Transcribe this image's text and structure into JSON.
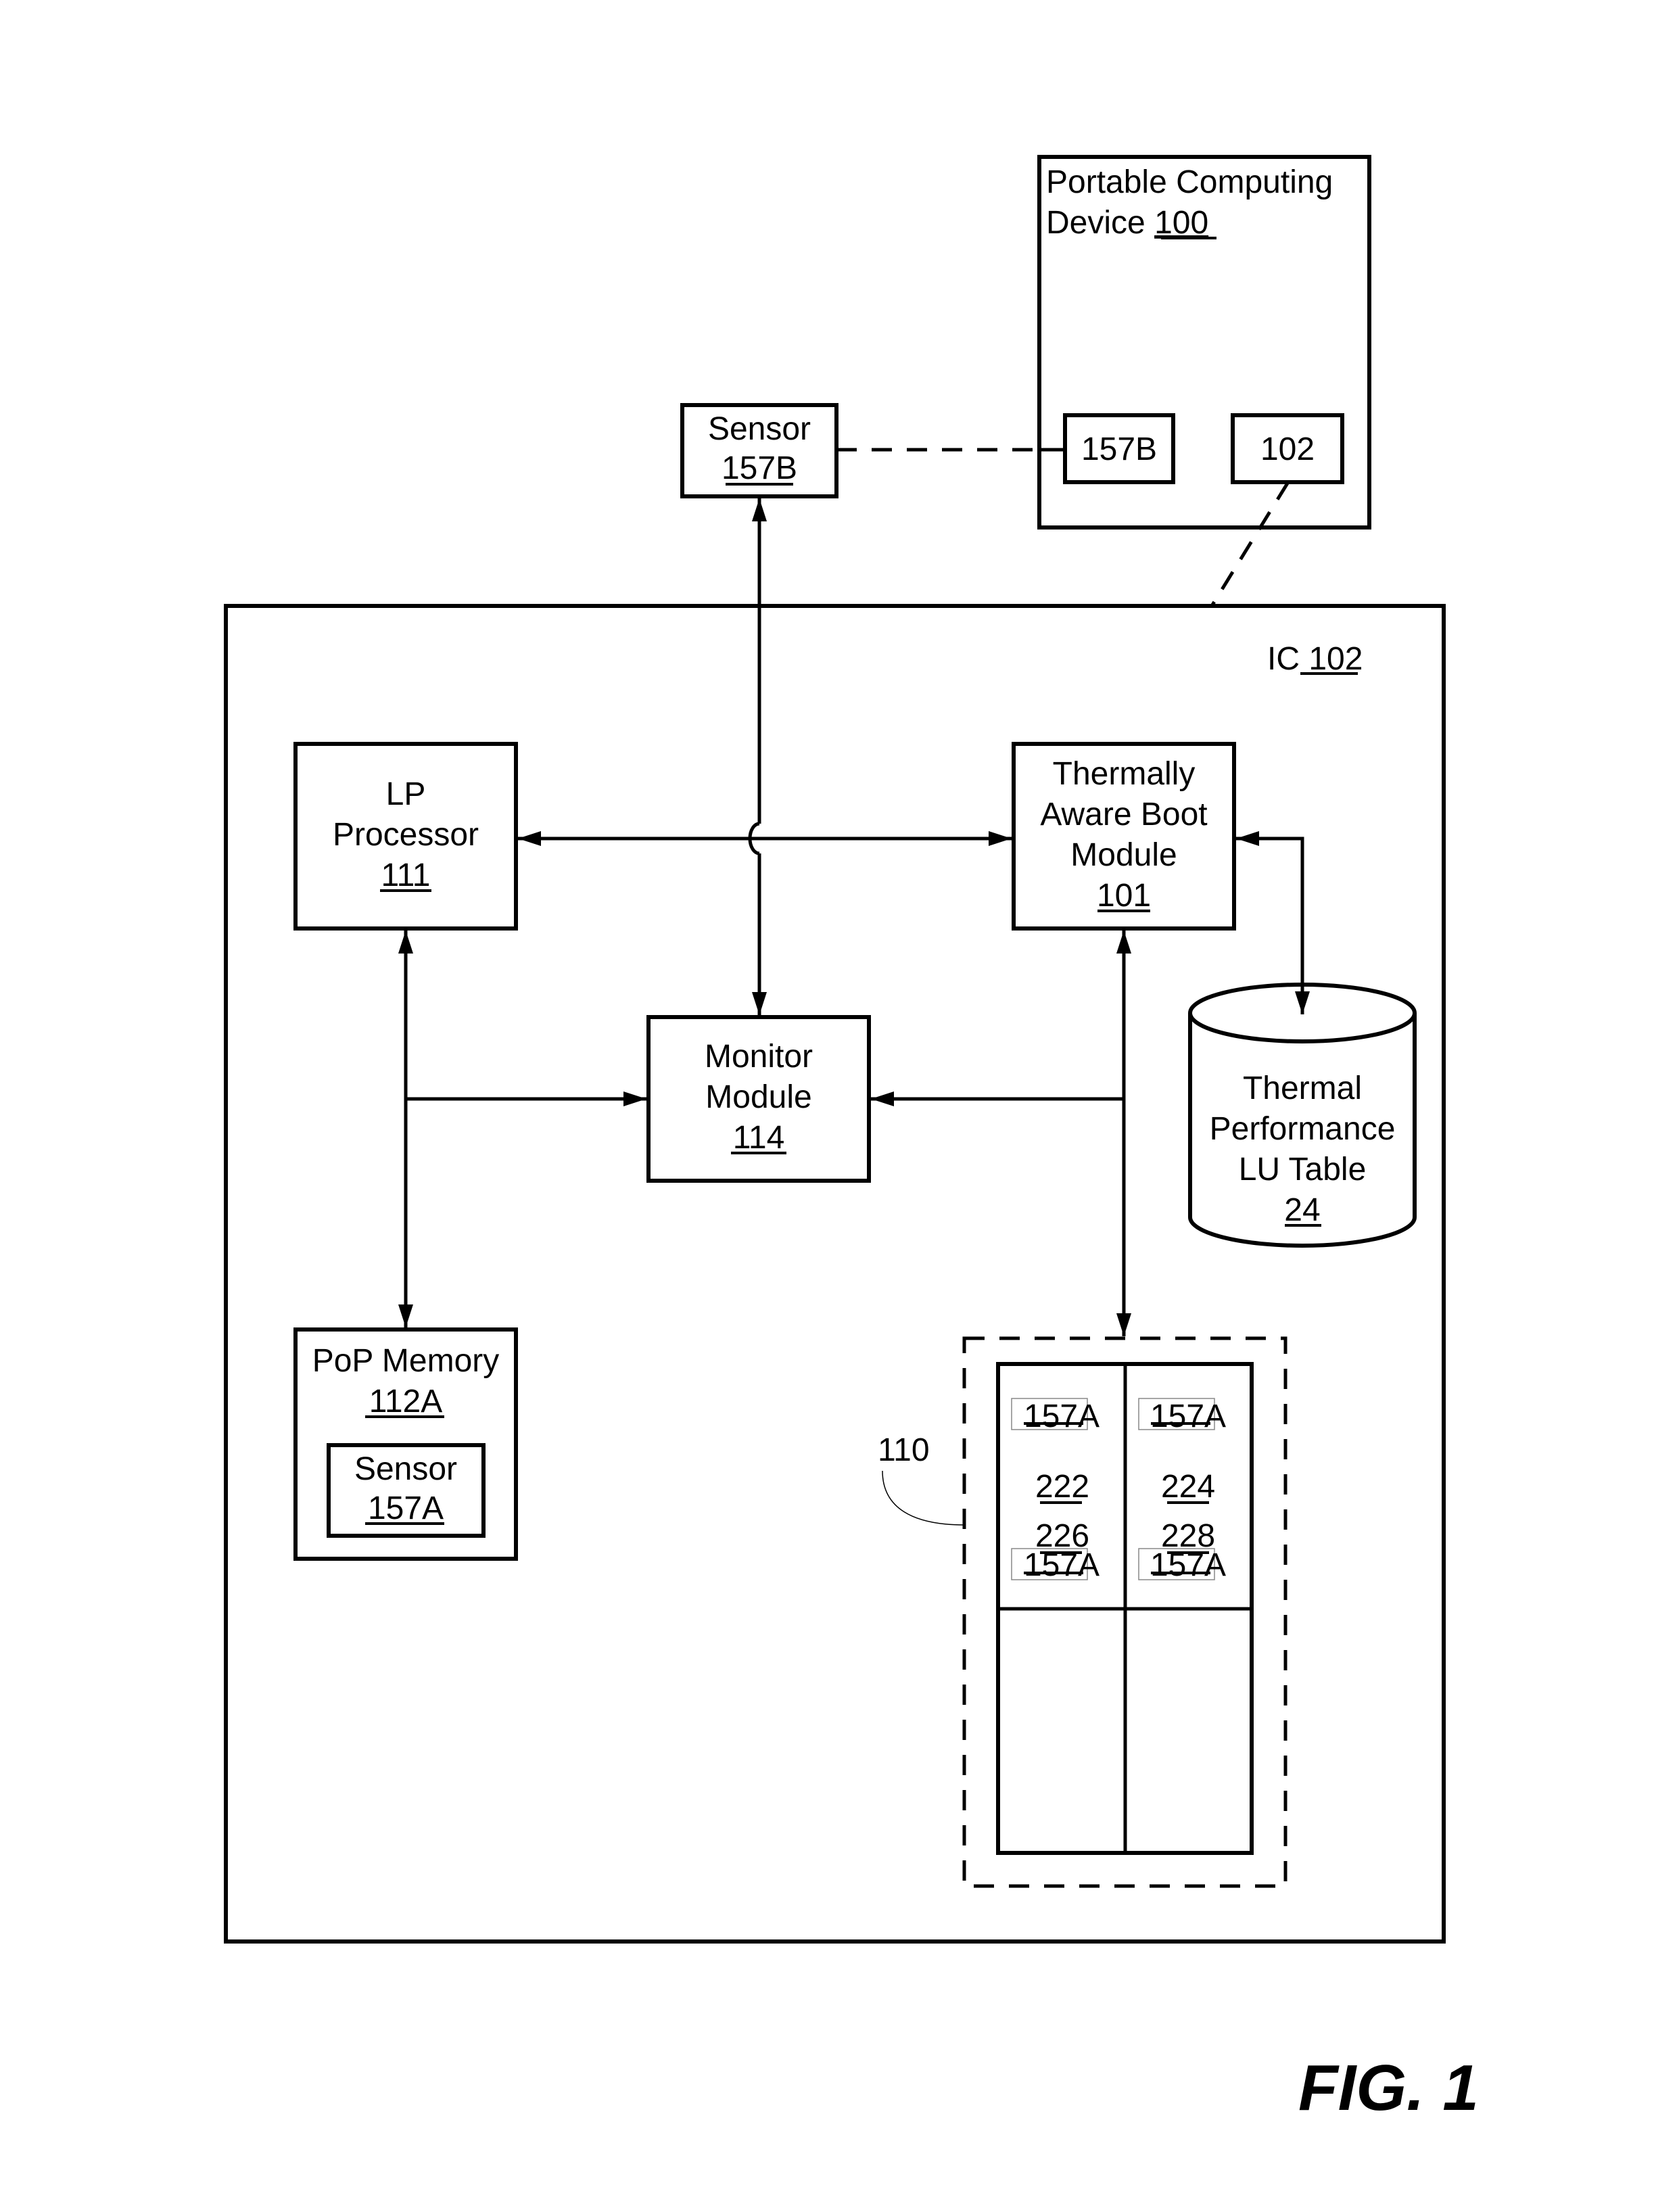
{
  "figure_label": "FIG. 1",
  "colors": {
    "ink": "#000000",
    "paper": "#ffffff",
    "thin_box": "#888888"
  },
  "portable_device": {
    "title_line1": "Portable Computing",
    "title_line2_prefix": "Device ",
    "ref": "100",
    "inner_sensor_ref": "157B",
    "inner_ic_ref": "102"
  },
  "external_sensor": {
    "label": "Sensor",
    "ref": "157B"
  },
  "ic": {
    "label_prefix": "IC ",
    "ref": "102"
  },
  "lp_processor": {
    "line1": "LP",
    "line2": "Processor",
    "ref": "111"
  },
  "boot_module": {
    "line1": "Thermally",
    "line2": "Aware Boot",
    "line3": "Module",
    "ref": "101"
  },
  "monitor_module": {
    "line1": "Monitor",
    "line2": "Module",
    "ref": "114"
  },
  "lu_table": {
    "line1": "Thermal",
    "line2": "Performance",
    "line3": "LU Table",
    "ref": "24"
  },
  "pop_memory": {
    "line1": "PoP Memory",
    "ref": "112A",
    "sensor_label": "Sensor",
    "sensor_ref": "157A"
  },
  "cores": {
    "group_ref": "110",
    "cells": [
      {
        "ref": "222",
        "sensor_ref": "157A"
      },
      {
        "ref": "224",
        "sensor_ref": "157A"
      },
      {
        "ref": "226",
        "sensor_ref": "157A"
      },
      {
        "ref": "228",
        "sensor_ref": "157A"
      }
    ]
  }
}
